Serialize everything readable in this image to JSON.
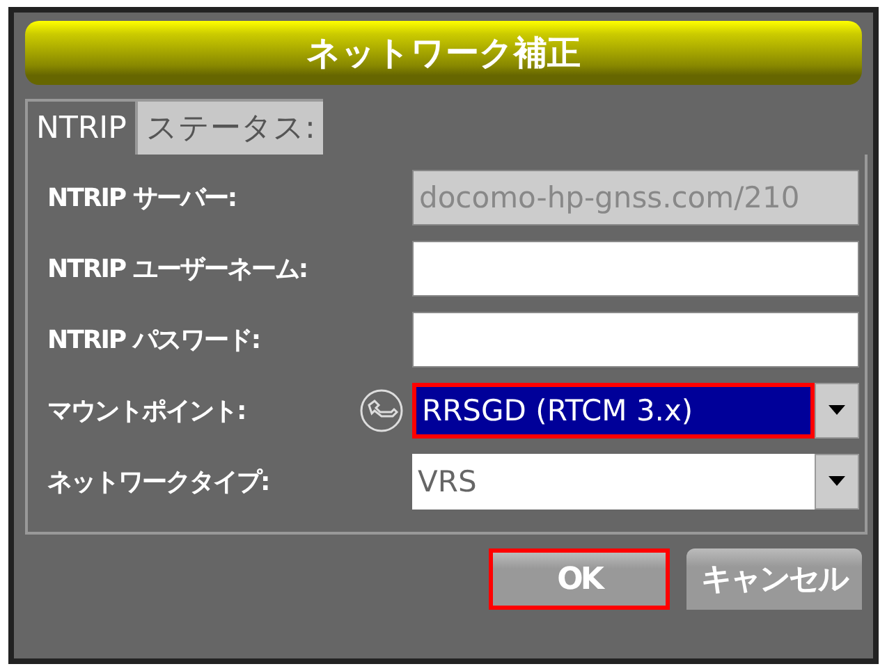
{
  "window": {
    "title": "ネットワーク補正"
  },
  "tabs": [
    {
      "label": "NTRIP",
      "selected": true
    },
    {
      "label": "ステータス:",
      "selected": false
    }
  ],
  "fields": [
    {
      "kind": "text",
      "label": "NTRIP サーバー:",
      "value": "docomo-hp-gnss.com/210",
      "disabled": true,
      "focused": false
    },
    {
      "kind": "text",
      "label": "NTRIP ユーザーネーム:",
      "disabled": false,
      "focused": false
    },
    {
      "kind": "password",
      "label": "NTRIP パスワード:",
      "disabled": false,
      "focused": false
    },
    {
      "kind": "dropdown",
      "label": "マウントポイント:",
      "value": "RRSGD (RTCM 3.x)",
      "disabled": false,
      "focused": true,
      "tool": true
    },
    {
      "kind": "dropdown",
      "label": "ネットワークタイプ:",
      "value": "VRS",
      "disabled": false,
      "focused": false,
      "tool": false
    }
  ],
  "buttons": [
    {
      "label": "OK",
      "focused": true
    },
    {
      "label": "キャンセル",
      "focused": false
    }
  ]
}
